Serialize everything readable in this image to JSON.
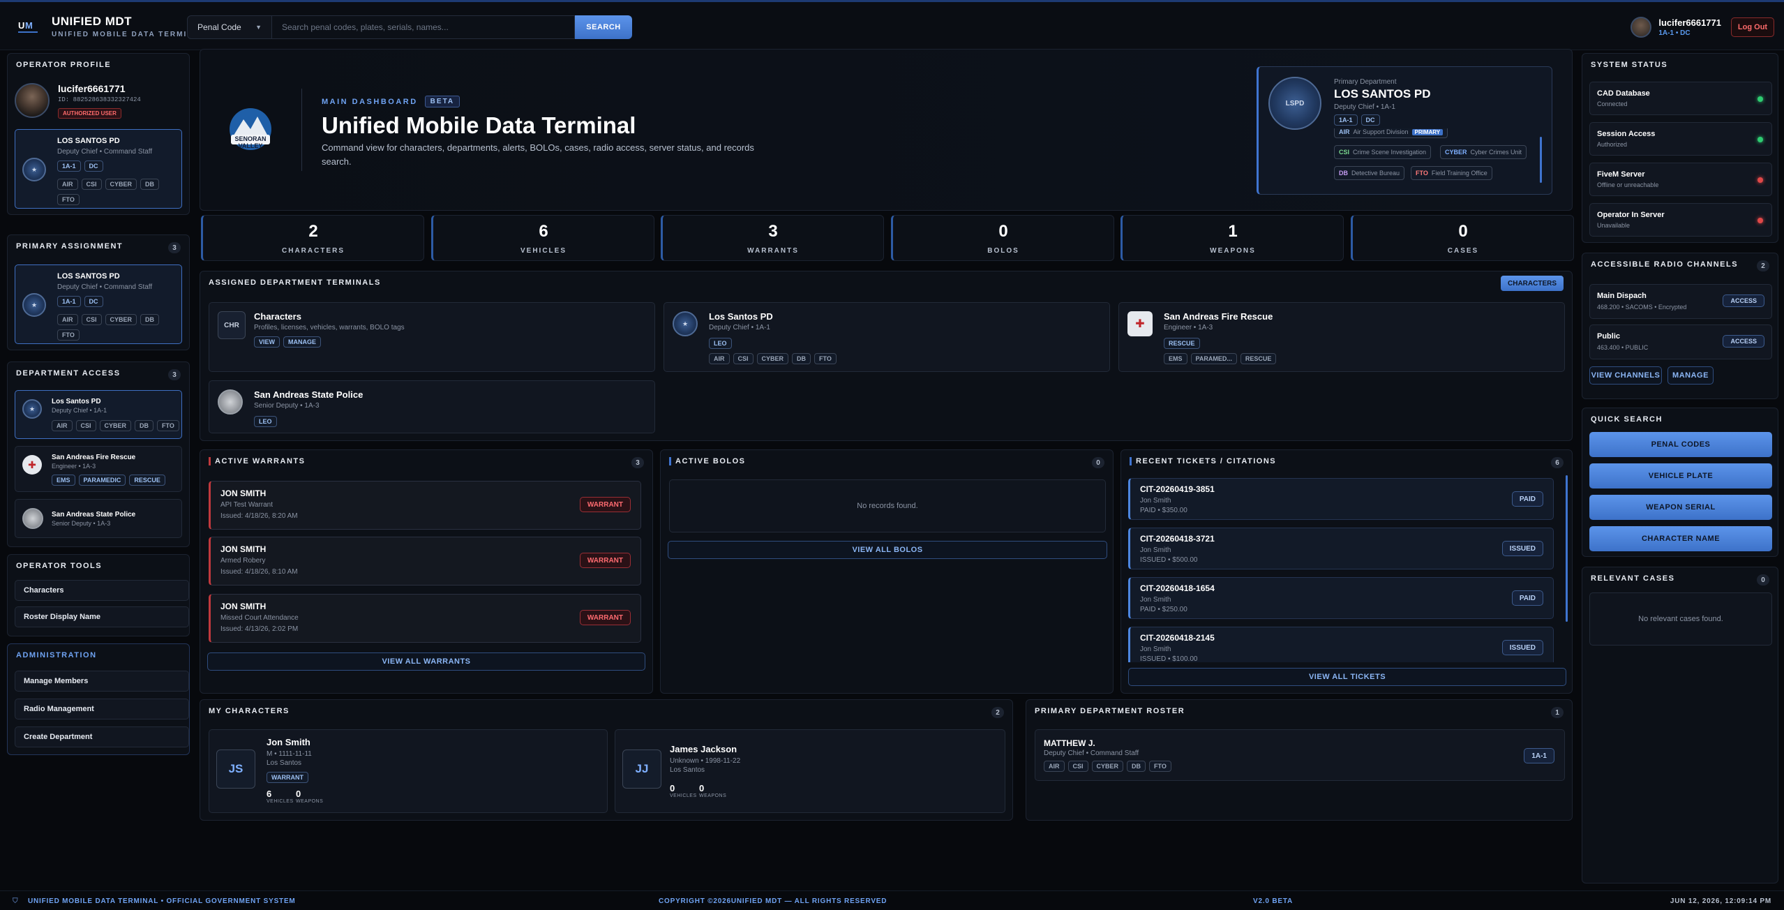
{
  "brand": {
    "title": "UNIFIED MDT",
    "subtitle": "UNIFIED MOBILE DATA TERMINAL"
  },
  "search": {
    "category": "Penal Code",
    "placeholder": "Search penal codes, plates, serials, names...",
    "button": "SEARCH"
  },
  "user": {
    "name": "lucifer6661771",
    "subtitle": "1A-1 • DC",
    "logout": "Log Out",
    "id": "ID: 882528638332327424",
    "badge": "AUTHORIZED USER"
  },
  "operator_profile": {
    "title": "OPERATOR PROFILE",
    "dept": "LOS SANTOS PD",
    "role": "Deputy Chief • Command Staff",
    "tags": [
      "1A-1",
      "DC"
    ],
    "divisions": [
      "AIR",
      "CSI",
      "CYBER",
      "DB",
      "FTO"
    ]
  },
  "primary_assignment": {
    "title": "PRIMARY ASSIGNMENT",
    "count": "3",
    "dept": "LOS SANTOS PD",
    "role": "Deputy Chief • Command Staff",
    "tags": [
      "1A-1",
      "DC"
    ],
    "divisions": [
      "AIR",
      "CSI",
      "CYBER",
      "DB",
      "FTO"
    ]
  },
  "department_access": {
    "title": "DEPARTMENT ACCESS",
    "count": "3",
    "items": [
      {
        "name": "Los Santos PD",
        "role": "Deputy Chief • 1A-1",
        "tags": [
          "AIR",
          "CSI",
          "CYBER",
          "DB",
          "FTO"
        ]
      },
      {
        "name": "San Andreas Fire Rescue",
        "role": "Engineer • 1A-3",
        "tags": [
          "EMS",
          "PARAMEDIC",
          "RESCUE"
        ]
      },
      {
        "name": "San Andreas State Police",
        "role": "Senior Deputy • 1A-3",
        "tags": []
      }
    ]
  },
  "operator_tools": {
    "title": "OPERATOR TOOLS",
    "items": [
      "Characters",
      "Roster Display Name"
    ]
  },
  "administration": {
    "title": "ADMINISTRATION",
    "items": [
      "Manage Members",
      "Radio Management",
      "Create Department"
    ]
  },
  "hero": {
    "kicker": "MAIN DASHBOARD",
    "beta": "BETA",
    "title": "Unified Mobile Data Terminal",
    "desc": "Command view for characters, departments, alerts, BOLOs, cases, radio access, server status, and records search.",
    "logo_text": "SENORAN VALLEY"
  },
  "primary_dept": {
    "label": "Primary Department",
    "name": "LOS SANTOS PD",
    "role": "Deputy Chief • 1A-1",
    "tags": [
      "1A-1",
      "DC"
    ],
    "divisions": [
      {
        "code": "AIR",
        "name": "Air Support Division",
        "badge": "PRIMARY"
      },
      {
        "code": "CSI",
        "name": "Crime Scene Investigation"
      },
      {
        "code": "CYBER",
        "name": "Cyber Crimes Unit"
      },
      {
        "code": "DB",
        "name": "Detective Bureau"
      },
      {
        "code": "FTO",
        "name": "Field Training Office"
      }
    ]
  },
  "stats": [
    {
      "value": "2",
      "label": "CHARACTERS"
    },
    {
      "value": "6",
      "label": "VEHICLES"
    },
    {
      "value": "3",
      "label": "WARRANTS"
    },
    {
      "value": "0",
      "label": "BOLOS"
    },
    {
      "value": "1",
      "label": "WEAPONS"
    },
    {
      "value": "0",
      "label": "CASES"
    }
  ],
  "terminals": {
    "title": "ASSIGNED DEPARTMENT TERMINALS",
    "button": "CHARACTERS",
    "items": [
      {
        "icon": "CHR",
        "name": "Characters",
        "sub": "Profiles, licenses, vehicles, warrants, BOLO tags",
        "actions": [
          "VIEW",
          "MANAGE"
        ]
      },
      {
        "name": "Los Santos PD",
        "sub": "Deputy Chief • 1A-1",
        "type": "LEO",
        "tags": [
          "AIR",
          "CSI",
          "CYBER",
          "DB",
          "FTO"
        ]
      },
      {
        "name": "San Andreas Fire Rescue",
        "sub": "Engineer • 1A-3",
        "type": "RESCUE",
        "tags": [
          "EMS",
          "PARAMED...",
          "RESCUE"
        ]
      },
      {
        "name": "San Andreas State Police",
        "sub": "Senior Deputy • 1A-3",
        "type": "LEO"
      }
    ]
  },
  "warrants": {
    "title": "ACTIVE WARRANTS",
    "count": "3",
    "button": "VIEW ALL WARRANTS",
    "items": [
      {
        "name": "JON SMITH",
        "charge": "API Test Warrant",
        "issued": "Issued: 4/18/26, 8:20 AM",
        "badge": "WARRANT"
      },
      {
        "name": "JON SMITH",
        "charge": "Armed Robery",
        "issued": "Issued: 4/18/26, 8:10 AM",
        "badge": "WARRANT"
      },
      {
        "name": "JON SMITH",
        "charge": "Missed Court Attendance",
        "issued": "Issued: 4/13/26, 2:02 PM",
        "badge": "WARRANT"
      }
    ]
  },
  "bolos": {
    "title": "ACTIVE BOLOS",
    "count": "0",
    "empty": "No records found.",
    "button": "VIEW ALL BOLOS"
  },
  "tickets": {
    "title": "RECENT TICKETS / CITATIONS",
    "count": "6",
    "button": "VIEW ALL TICKETS",
    "items": [
      {
        "id": "CIT-20260419-3851",
        "name": "Jon Smith",
        "detail": "PAID • $350.00",
        "status": "PAID"
      },
      {
        "id": "CIT-20260418-3721",
        "name": "Jon Smith",
        "detail": "ISSUED • $500.00",
        "status": "ISSUED"
      },
      {
        "id": "CIT-20260418-1654",
        "name": "Jon Smith",
        "detail": "PAID • $250.00",
        "status": "PAID"
      },
      {
        "id": "CIT-20260418-2145",
        "name": "Jon Smith",
        "detail": "ISSUED • $100.00",
        "status": "ISSUED"
      }
    ]
  },
  "my_characters": {
    "title": "MY CHARACTERS",
    "count": "2",
    "items": [
      {
        "initials": "JS",
        "name": "Jon Smith",
        "info": "M • 1111-11-11",
        "city": "Los Santos",
        "badge": "WARRANT",
        "vehicles": "6",
        "weapons": "0"
      },
      {
        "initials": "JJ",
        "name": "James Jackson",
        "info": "Unknown • 1998-11-22",
        "city": "Los Santos",
        "vehicles": "0",
        "weapons": "0"
      }
    ],
    "vehicles_label": "VEHICLES",
    "weapons_label": "WEAPONS"
  },
  "roster": {
    "title": "PRIMARY DEPARTMENT ROSTER",
    "count": "1",
    "name": "MATTHEW J.",
    "role": "Deputy Chief • Command Staff",
    "callsign": "1A-1",
    "tags": [
      "AIR",
      "CSI",
      "CYBER",
      "DB",
      "FTO"
    ]
  },
  "system_status": {
    "title": "SYSTEM STATUS",
    "items": [
      {
        "name": "CAD Database",
        "state": "Connected",
        "color": "#2ecc71"
      },
      {
        "name": "Session Access",
        "state": "Authorized",
        "color": "#2ecc71"
      },
      {
        "name": "FiveM Server",
        "state": "Offline or unreachable",
        "color": "#e04848"
      },
      {
        "name": "Operator In Server",
        "state": "Unavailable",
        "color": "#e04848"
      }
    ]
  },
  "radio": {
    "title": "ACCESSIBLE RADIO CHANNELS",
    "count": "2",
    "items": [
      {
        "name": "Main Dispach",
        "freq": "468.200 • SACOMS • Encrypted",
        "btn": "ACCESS"
      },
      {
        "name": "Public",
        "freq": "463.400 • PUBLIC",
        "btn": "ACCESS"
      }
    ],
    "view": "VIEW CHANNELS",
    "manage": "MANAGE"
  },
  "quick_search": {
    "title": "QUICK SEARCH",
    "items": [
      "PENAL CODES",
      "VEHICLE PLATE",
      "WEAPON SERIAL",
      "CHARACTER NAME"
    ]
  },
  "cases": {
    "title": "RELEVANT CASES",
    "count": "0",
    "empty": "No relevant cases found."
  },
  "footer": {
    "left": "UNIFIED MOBILE DATA TERMINAL • OFFICIAL GOVERNMENT SYSTEM",
    "center": "COPYRIGHT ©2026UNIFIED MDT — ALL RIGHTS RESERVED",
    "version": "V2.0 BETA",
    "time": "JUN 12, 2026, 12:09:14 PM"
  }
}
